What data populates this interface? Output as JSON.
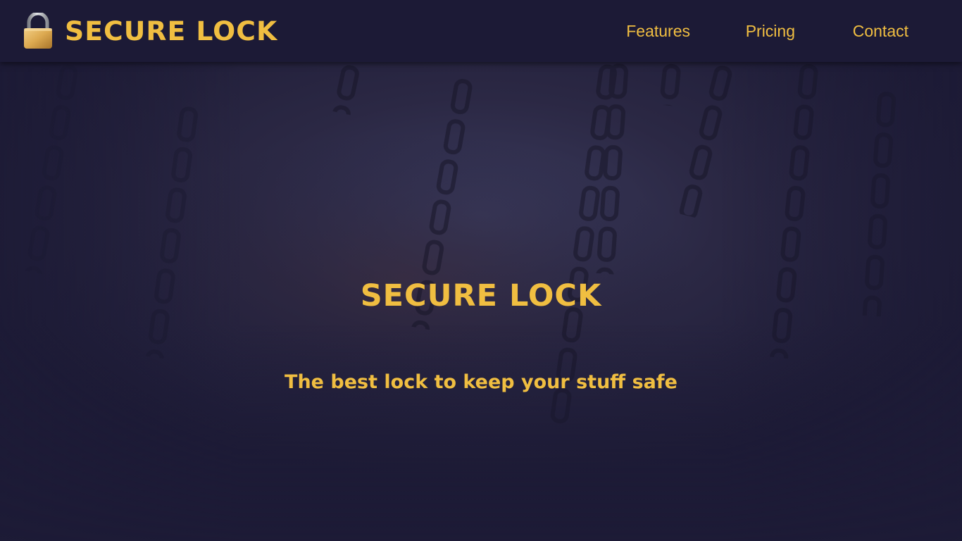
{
  "nav": {
    "brand_name": "SECURE LOCK",
    "brand_icon": "padlock-icon",
    "links": [
      {
        "label": "Features"
      },
      {
        "label": "Pricing"
      },
      {
        "label": "Contact"
      }
    ]
  },
  "hero": {
    "title": "SECURE LOCK",
    "subtitle": "The best lock to keep your stuff safe",
    "background": "hanging-chains-image"
  },
  "colors": {
    "accent": "#f0be41",
    "navbar": "#1c1a36",
    "background": "#1e1c38"
  }
}
